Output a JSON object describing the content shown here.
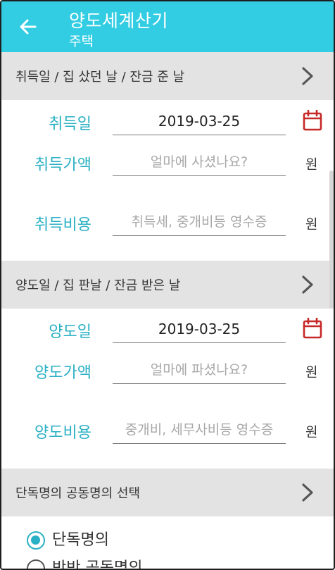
{
  "appbar": {
    "title": "양도세계산기",
    "subtitle": "주택",
    "background": "#33cde3"
  },
  "icons": {
    "back": "arrow-left-icon",
    "chevron": "chevron-right-icon",
    "calendar": "calendar-icon"
  },
  "acquisition": {
    "section_label": "취득일 / 집 샀던 날 / 잔금 준 날",
    "date_label": "취득일",
    "date_value": "2019-03-25",
    "price_label": "취득가액",
    "price_placeholder": "얼마에 사셨나요?",
    "price_unit": "원",
    "cost_label": "취득비용",
    "cost_placeholder": "취득세, 중개비등 영수증",
    "cost_unit": "원"
  },
  "transfer": {
    "section_label": "양도일 / 집 판날 / 잔금 받은 날",
    "date_label": "양도일",
    "date_value": "2019-03-25",
    "price_label": "양도가액",
    "price_placeholder": "얼마에 파셨나요?",
    "price_unit": "원",
    "cost_label": "양도비용",
    "cost_placeholder": "중개비, 세무사비등 영수증",
    "cost_unit": "원"
  },
  "ownership": {
    "section_label": "단독명의 공동명의 선택",
    "options": [
      "단독명의",
      "반반 공동명의"
    ],
    "selected": "단독명의"
  },
  "colors": {
    "accent": "#2ab0c4",
    "calendar": "#c62828",
    "section_bg": "#e3e3e3"
  }
}
